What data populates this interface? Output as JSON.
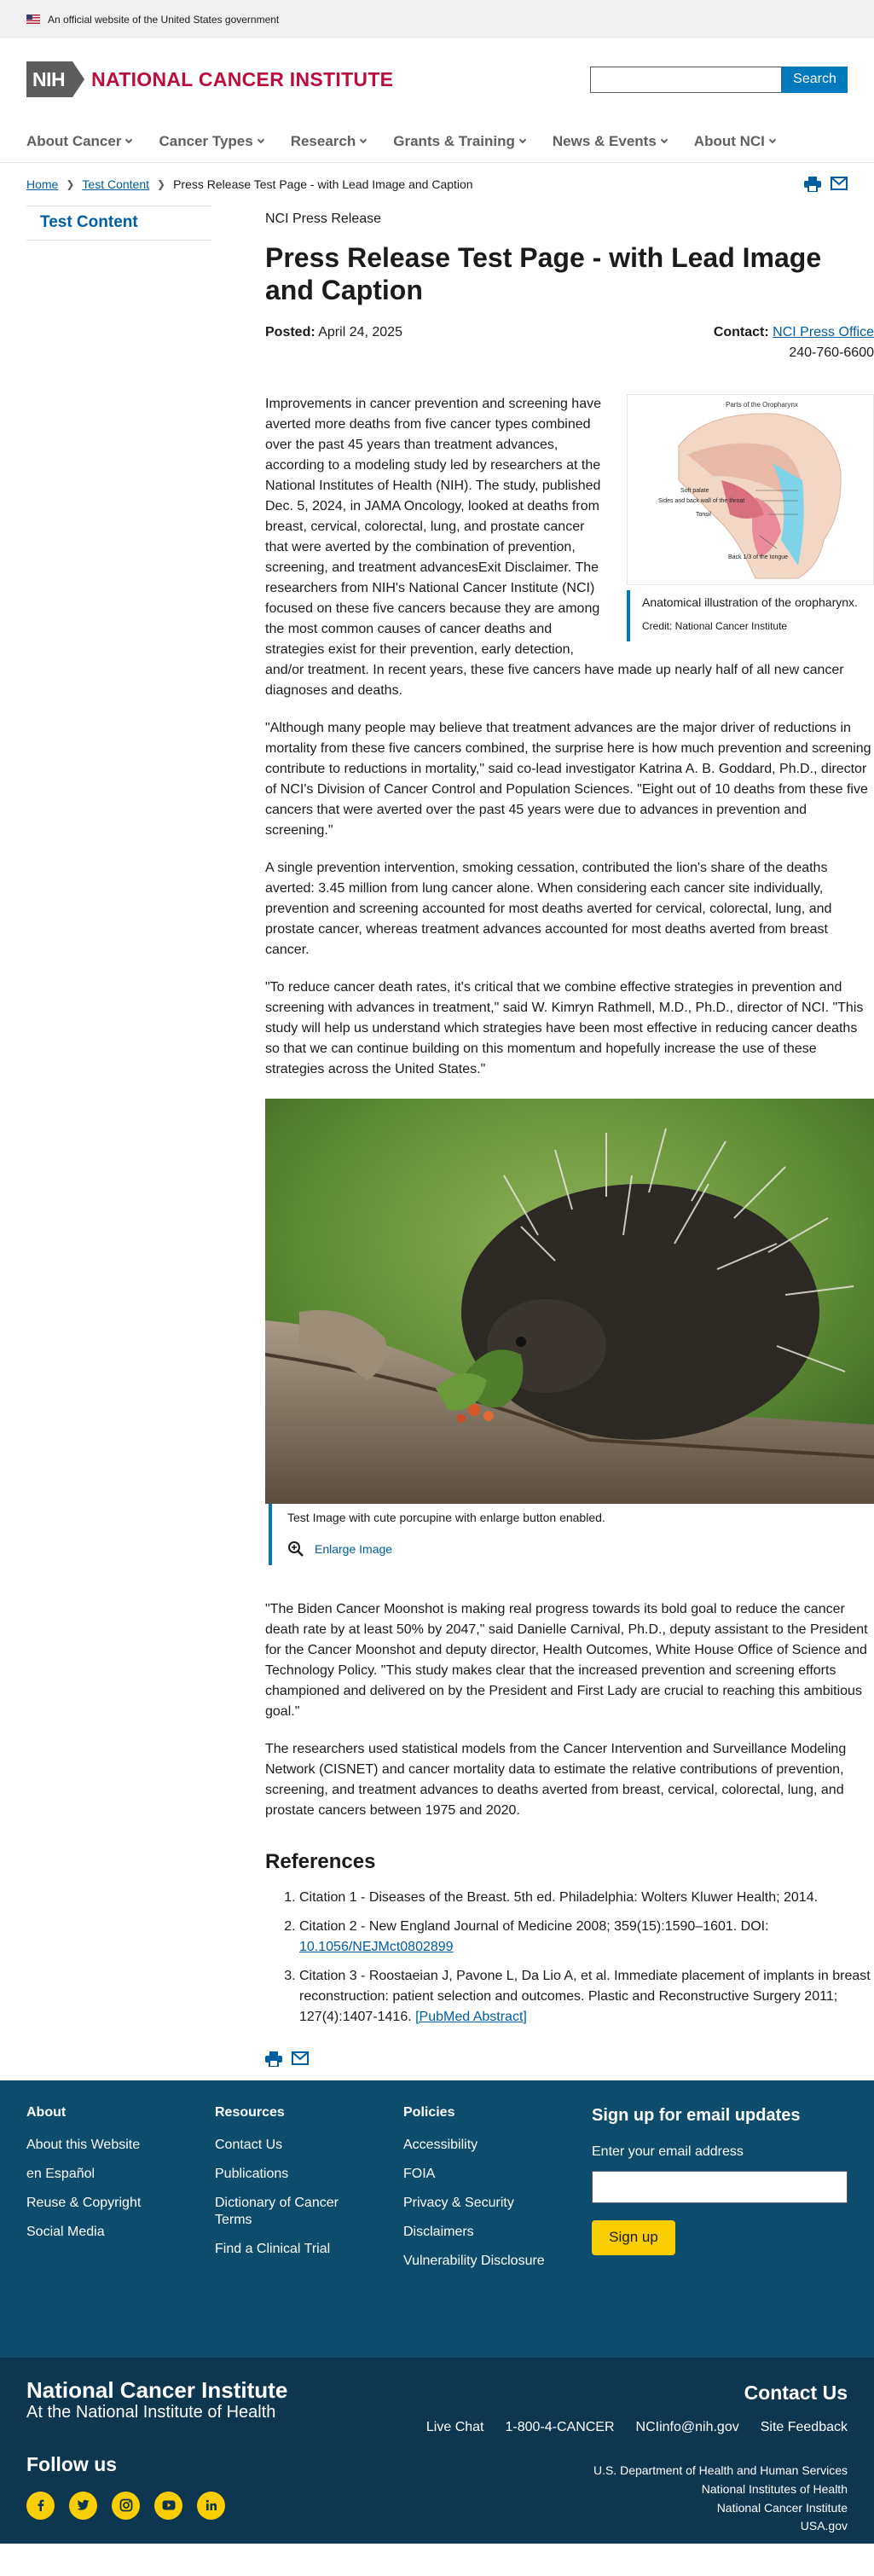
{
  "gov_banner": {
    "text": "An official website of the United States government"
  },
  "header": {
    "logo_badge": "NIH",
    "logo_text": "NATIONAL CANCER INSTITUTE",
    "search_placeholder": "",
    "search_button": "Search"
  },
  "nav": [
    {
      "label": "About Cancer"
    },
    {
      "label": "Cancer Types"
    },
    {
      "label": "Research"
    },
    {
      "label": "Grants & Training"
    },
    {
      "label": "News & Events"
    },
    {
      "label": "About NCI"
    }
  ],
  "breadcrumb": [
    "Home",
    "Test Content",
    "Press Release Test Page - with Lead Image and Caption"
  ],
  "sidebar": {
    "items": [
      "Test Content"
    ]
  },
  "article": {
    "eyebrow": "NCI Press Release",
    "title": "Press Release Test Page - with Lead Image and Caption",
    "posted_label": "Posted:",
    "posted_date": "April 24, 2025",
    "contact_label": "Contact:",
    "contact_link": "NCI Press Office",
    "contact_phone": "240-760-6600",
    "lead_figure": {
      "diagram_title": "Parts of the Oropharynx",
      "labels": [
        "Soft palate",
        "Sides and back wall of the throat",
        "Tonsil",
        "Back 1/3 of the tongue"
      ],
      "caption": "Anatomical illustration of the oropharynx.",
      "credit": "Credit: National Cancer Institute"
    },
    "paragraphs": [
      "Improvements in cancer prevention and screening have averted more deaths from five cancer types combined over the past 45 years than treatment advances, according to a modeling study led by researchers at the National Institutes of Health (NIH). The study, published Dec. 5, 2024, in JAMA Oncology, looked at deaths from breast, cervical, colorectal, lung, and prostate cancer that were averted by the combination of prevention, screening, and treatment advancesExit Disclaimer. The researchers from NIH's National Cancer Institute (NCI) focused on these five cancers because they are among the most common causes of cancer deaths and strategies exist for their prevention, early detection, and/or treatment. In recent years, these five cancers have made up nearly half of all new cancer diagnoses and deaths.",
      "\"Although many people may believe that treatment advances are the major driver of reductions in mortality from these five cancers combined, the surprise here is how much prevention and screening contribute to reductions in mortality,\" said co-lead investigator Katrina A. B. Goddard, Ph.D., director of NCI's Division of Cancer Control and Population Sciences. \"Eight out of 10 deaths from these five cancers that were averted over the past 45 years were due to advances in prevention and screening.\"",
      "A single prevention intervention, smoking cessation, contributed the lion's share of the deaths averted: 3.45 million from lung cancer alone. When considering each cancer site individually, prevention and screening accounted for most deaths averted for cervical, colorectal, lung, and prostate cancer, whereas treatment advances accounted for most deaths averted from breast cancer.",
      "\"To reduce cancer death rates, it's critical that we combine effective strategies in prevention and screening with advances in treatment,\" said W. Kimryn Rathmell, M.D., Ph.D., director of NCI. \"This study will help us understand which strategies have been most effective in reducing cancer deaths so that we can continue building on this momentum and hopefully increase the use of these strategies across the United States.\""
    ],
    "photo": {
      "caption": "Test Image with cute porcupine with enlarge button enabled.",
      "enlarge": "Enlarge Image"
    },
    "paragraphs_after": [
      "\"The Biden Cancer Moonshot is making real progress towards its bold goal to reduce the cancer death rate by at least 50% by 2047,\" said Danielle Carnival, Ph.D., deputy assistant to the President for the Cancer Moonshot and deputy director, Health Outcomes, White House Office of Science and Technology Policy. \"This study makes clear that the increased prevention and screening efforts championed and delivered on by the President and First Lady are crucial to reaching this ambitious goal.\"",
      "The researchers used statistical models from the Cancer Intervention and Surveillance Modeling Network (CISNET) and cancer mortality data to estimate the relative contributions of prevention, screening, and treatment advances to deaths averted from breast, cervical, colorectal, lung, and prostate cancers between 1975 and 2020."
    ],
    "references_title": "References",
    "references": [
      {
        "text": "Citation 1 - Diseases of the Breast. 5th ed. Philadelphia: Wolters Kluwer Health; 2014.",
        "link": ""
      },
      {
        "text": "Citation 2 - New England Journal of Medicine 2008; 359(15):1590–1601. DOI:",
        "link": "10.1056/NEJMct0802899"
      },
      {
        "text": "Citation 3 - Roostaeian J, Pavone L, Da Lio A, et al. Immediate placement of implants in breast reconstruction: patient selection and outcomes. Plastic and Reconstructive Surgery 2011; 127(4):1407-1416.",
        "link": "[PubMed Abstract]"
      }
    ]
  },
  "footer": {
    "columns": [
      {
        "title": "About",
        "links": [
          "About this Website",
          "en Español",
          "Reuse & Copyright",
          "Social Media"
        ]
      },
      {
        "title": "Resources",
        "links": [
          "Contact Us",
          "Publications",
          "Dictionary of Cancer Terms",
          "Find a Clinical Trial"
        ]
      },
      {
        "title": "Policies",
        "links": [
          "Accessibility",
          "FOIA",
          "Privacy & Security",
          "Disclaimers",
          "Vulnerability Disclosure"
        ]
      }
    ],
    "signup": {
      "title": "Sign up for email updates",
      "label": "Enter your email address",
      "button": "Sign up"
    },
    "org_name": "National Cancer Institute",
    "org_sub": "At the National Institute of Health",
    "follow": "Follow us",
    "contact_title": "Contact Us",
    "contact_links": [
      "Live Chat",
      "1-800-4-CANCER",
      "NCIinfo@nih.gov",
      "Site Feedback"
    ],
    "agencies": [
      "U.S. Department of Health and Human Services",
      "National Institutes of Health",
      "National Cancer Institute",
      "USA.gov"
    ]
  },
  "colors": {
    "brand_red": "#bb0e3d",
    "link_blue": "#005ea2",
    "accent_blue": "#007abd",
    "footer_dark": "#0e4c6d",
    "footer_darker": "#0d3650",
    "yellow": "#face00"
  }
}
